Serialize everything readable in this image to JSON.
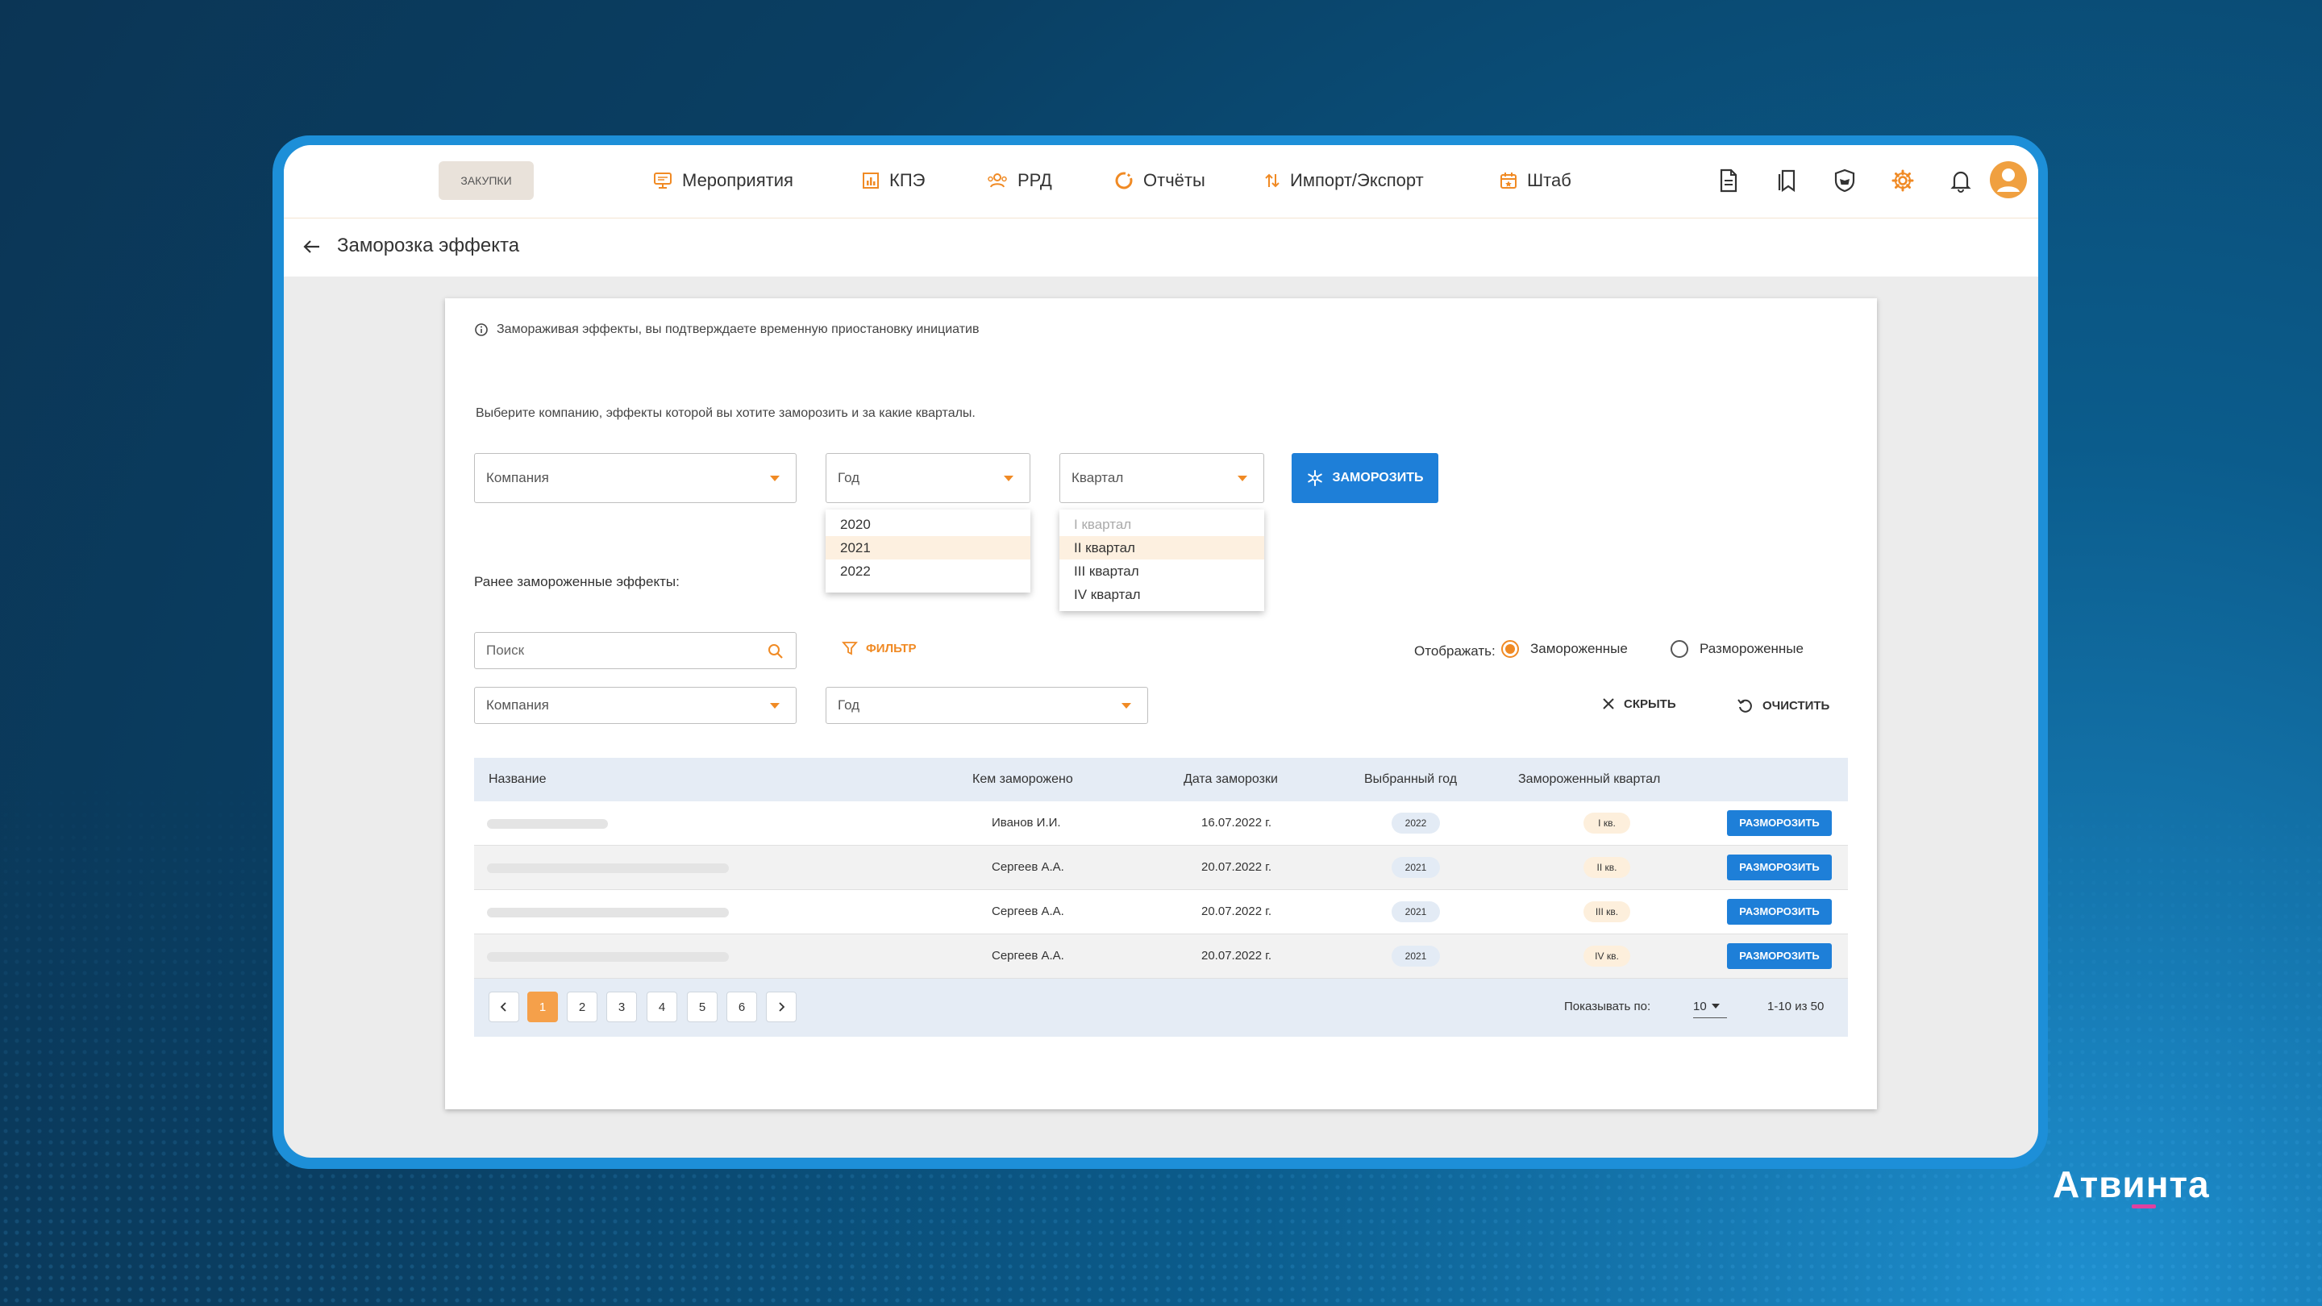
{
  "app": {
    "logo_label": "ЗАКУПКИ",
    "nav": [
      {
        "label": "Мероприятия",
        "icon": "monitor-icon"
      },
      {
        "label": "КПЭ",
        "icon": "bar-chart-icon"
      },
      {
        "label": "РРД",
        "icon": "users-icon"
      },
      {
        "label": "Отчёты",
        "icon": "refresh-icon"
      },
      {
        "label": "Импорт/Экспорт",
        "icon": "import-export-icon"
      },
      {
        "label": "Штаб",
        "icon": "calendar-icon"
      }
    ],
    "right_icons": [
      "document-icon",
      "bookmarks-icon",
      "shield-icon",
      "gear-icon",
      "bell-icon",
      "avatar-icon"
    ],
    "accent_color": "#f08a24",
    "primary_color": "#1e7fd8"
  },
  "page": {
    "title": "Заморозка эффекта"
  },
  "form": {
    "info_text": "Замораживая эффекты, вы подтверждаете временную приостановку инициатив",
    "prompt": "Выберите компанию, эффекты которой вы хотите заморозить и за какие кварталы.",
    "company_placeholder": "Компания",
    "year_placeholder": "Год",
    "quarter_placeholder": "Квартал",
    "freeze_button": "ЗАМОРОЗИТЬ",
    "year_options": [
      "2020",
      "2021",
      "2022"
    ],
    "year_selected": "2021",
    "quarter_options": [
      "I квартал",
      "II квартал",
      "III квартал",
      "IV квартал"
    ],
    "quarter_selected": "II квартал",
    "quarter_disabled": "I квартал"
  },
  "list": {
    "section_label": "Ранее замороженные эффекты:",
    "search_placeholder": "Поиск",
    "filter_button": "ФИЛЬТР",
    "show_label": "Отображать:",
    "radio_frozen": "Замороженные",
    "radio_unfrozen": "Размороженные",
    "radio_selected": "Замороженные",
    "company_placeholder": "Компания",
    "year_placeholder": "Год",
    "hide_button": "СКРЫТЬ",
    "clear_button": "ОЧИСТИТЬ"
  },
  "table": {
    "columns": [
      "Название",
      "Кем заморожено",
      "Дата заморозки",
      "Выбранный год",
      "Замороженный квартал"
    ],
    "rows": [
      {
        "by": "Иванов И.И.",
        "date": "16.07.2022 г.",
        "year": "2022",
        "quarter": "I кв.",
        "action": "РАЗМОРОЗИТЬ"
      },
      {
        "by": "Сергеев А.А.",
        "date": "20.07.2022 г.",
        "year": "2021",
        "quarter": "II кв.",
        "action": "РАЗМОРОЗИТЬ"
      },
      {
        "by": "Сергеев А.А.",
        "date": "20.07.2022 г.",
        "year": "2021",
        "quarter": "III кв.",
        "action": "РАЗМОРОЗИТЬ"
      },
      {
        "by": "Сергеев А.А.",
        "date": "20.07.2022 г.",
        "year": "2021",
        "quarter": "IV кв.",
        "action": "РАЗМОРОЗИТЬ"
      }
    ]
  },
  "pagination": {
    "pages": [
      "1",
      "2",
      "3",
      "4",
      "5",
      "6"
    ],
    "current": "1",
    "per_page_label": "Показывать по:",
    "per_page": "10",
    "range": "1-10 из 50"
  },
  "brand": {
    "name": "Атвинта"
  }
}
